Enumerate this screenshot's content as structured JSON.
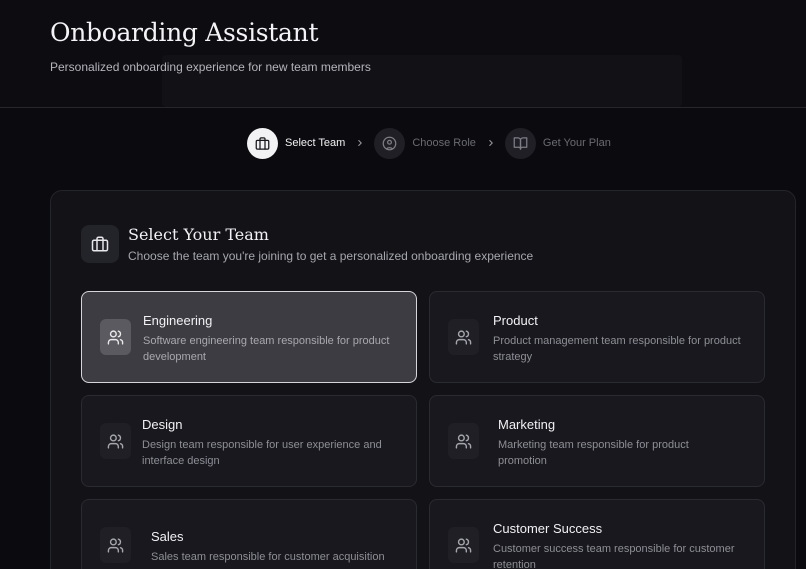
{
  "header": {
    "title": "Onboarding Assistant",
    "subtitle": "Personalized onboarding experience for new team members"
  },
  "stepper": [
    {
      "label": "Select Team",
      "icon": "briefcase-icon",
      "active": true
    },
    {
      "label": "Choose Role",
      "icon": "user-circle-icon",
      "active": false
    },
    {
      "label": "Get Your Plan",
      "icon": "book-open-icon",
      "active": false
    }
  ],
  "panel": {
    "icon": "briefcase-icon",
    "title": "Select Your Team",
    "description": "Choose the team you're joining to get a personalized onboarding experience"
  },
  "teams": [
    {
      "name": "Engineering",
      "description": "Software engineering team responsible for product development",
      "icon": "users-icon",
      "selected": true
    },
    {
      "name": "Product",
      "description": "Product management team responsible for product strategy",
      "icon": "users-icon",
      "selected": false
    },
    {
      "name": "Design",
      "description": "Design team responsible for user experience and interface design",
      "icon": "users-icon",
      "selected": false
    },
    {
      "name": "Marketing",
      "description": "Marketing team responsible for product promotion",
      "icon": "users-icon",
      "selected": false
    },
    {
      "name": "Sales",
      "description": "Sales team responsible for customer acquisition",
      "icon": "users-icon",
      "selected": false
    },
    {
      "name": "Customer Success",
      "description": "Customer success team responsible for customer retention",
      "icon": "users-icon",
      "selected": false
    }
  ]
}
